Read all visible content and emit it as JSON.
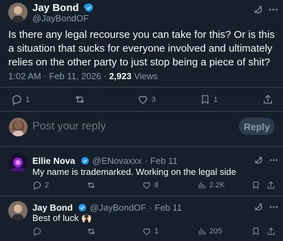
{
  "tweet": {
    "author_name": "Jay Bond",
    "author_handle": "@JayBondOF",
    "text": "Is there any legal recourse you can take for this? Or is this a situation that sucks for everyone involved and ultimately relies on the other party to just stop being a piece of shit?",
    "timestamp": "1:02 AM · Feb 11, 2026 · ",
    "views_count": "2,923",
    "views_label": " Views",
    "stats": {
      "replies": "1",
      "retweets": "",
      "likes": "3",
      "bookmarks": "1"
    }
  },
  "composer": {
    "placeholder": "Post your reply",
    "button_label": "Reply"
  },
  "replies": [
    {
      "name": "Ellie Nova",
      "handle": "@ENovaxxx",
      "date": "· Feb 11",
      "text": "My name is trademarked. Working on the legal side",
      "stats": {
        "replies": "2",
        "retweets": "",
        "likes": "8",
        "views": "2.2K"
      }
    },
    {
      "name": "Jay Bond",
      "handle": "@JayBondOF",
      "date": "· Feb 11",
      "text": "Best of luck 🙌🏻",
      "stats": {
        "replies": "",
        "retweets": "",
        "likes": "1",
        "views": "205"
      }
    }
  ],
  "colors": {
    "background": "#15202b",
    "verified": "#1d9bf0",
    "secondary_text": "#8b98a5",
    "divider": "#38444d"
  }
}
